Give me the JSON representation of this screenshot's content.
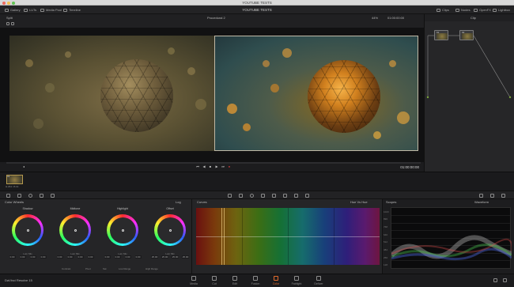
{
  "window": {
    "title": "YOUTUBE TESTS"
  },
  "toolbar": {
    "items": [
      "Gallery",
      "LUTs",
      "Media Pool",
      "Timeline"
    ],
    "project_title": "YOUTUBE TESTS",
    "right_items": [
      "Clips",
      "Nodes",
      "OpenFX",
      "Lightbox"
    ]
  },
  "viewer": {
    "label": "Split",
    "timecode": "01:00:00:00",
    "clip_name": "Procedural 2",
    "zoom": "44%"
  },
  "nodes": {
    "header": "Clip",
    "items": [
      "01",
      "02"
    ]
  },
  "clip_strip": {
    "clips": [
      {
        "number": "01",
        "codec": "H.264 / 8-bit"
      }
    ]
  },
  "color_wheels": {
    "title": "Color Wheels",
    "mode": "Log",
    "wheels": [
      {
        "name": "Shadow",
        "sub": "Lum Mix",
        "values": [
          "0.00",
          "0.00",
          "0.00",
          "0.00"
        ]
      },
      {
        "name": "Midtone",
        "sub": "Lum Mix",
        "values": [
          "0.00",
          "0.00",
          "0.00",
          "0.00"
        ]
      },
      {
        "name": "Highlight",
        "sub": "Lum Mix",
        "values": [
          "0.00",
          "0.00",
          "0.00",
          "0.00"
        ]
      },
      {
        "name": "Offset",
        "sub": "Lum Mix",
        "values": [
          "25.00",
          "25.00",
          "25.00",
          "25.00"
        ]
      }
    ],
    "bottom": [
      "Contrast",
      "Pivot",
      "Sat",
      "Low Range",
      "High Range"
    ]
  },
  "curves": {
    "title": "Curves",
    "mode": "Hue Vs Hue",
    "swatches": [
      "#d23a3a",
      "#d8c23a",
      "#3ac24a",
      "#3aa6d8",
      "#3a5ad8",
      "#c23ad8"
    ]
  },
  "scopes": {
    "title": "Scopes",
    "mode": "Waveform",
    "ticks": [
      "1023",
      "896",
      "768",
      "640",
      "512",
      "384",
      "256",
      "128",
      "0"
    ]
  },
  "pages": {
    "brand": "DaVinci Resolve 15",
    "tabs": [
      "Media",
      "Cut",
      "Edit",
      "Fusion",
      "Color",
      "Fairlight",
      "Deliver"
    ],
    "active": "Color"
  }
}
